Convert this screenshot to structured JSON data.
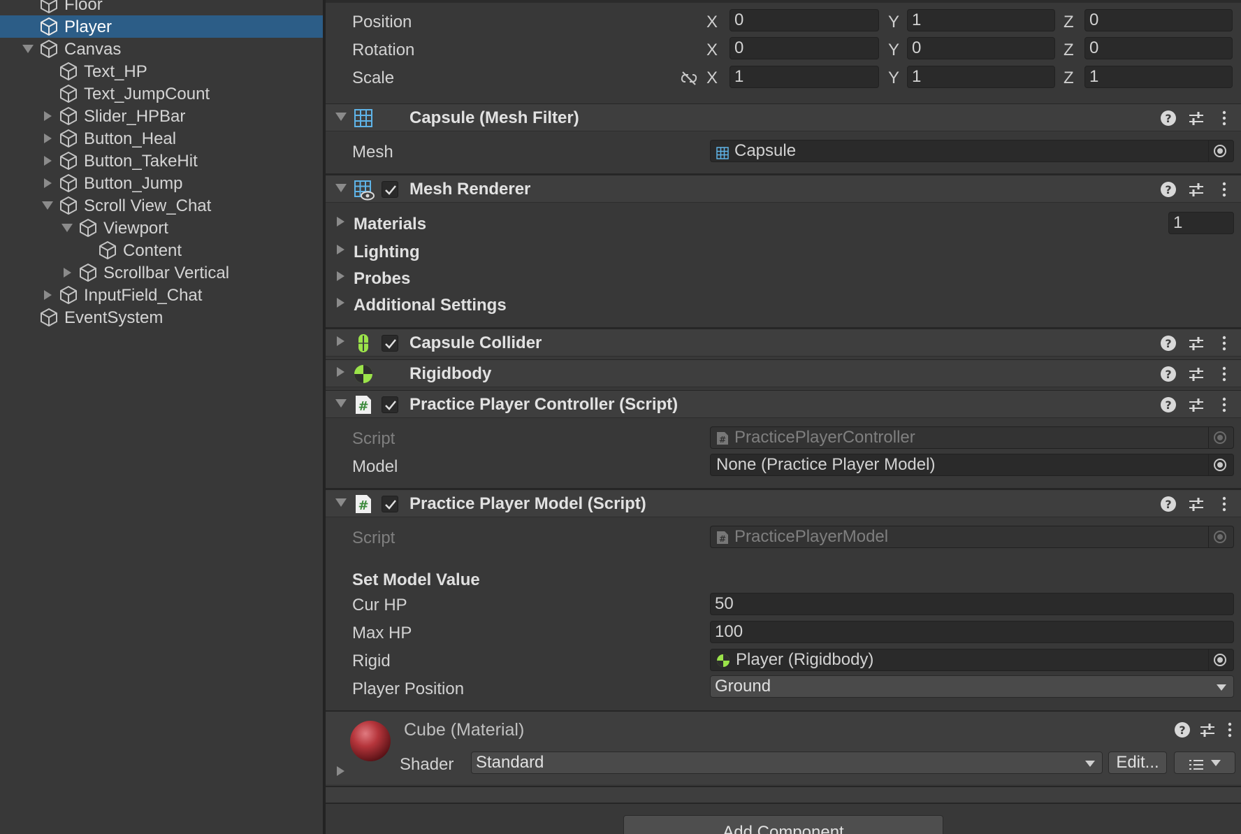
{
  "hierarchy": {
    "items": [
      {
        "label": "Floor",
        "indent": 0,
        "fold": "none",
        "selected": false
      },
      {
        "label": "Player",
        "indent": 0,
        "fold": "none",
        "selected": true
      },
      {
        "label": "Canvas",
        "indent": 0,
        "fold": "open",
        "selected": false
      },
      {
        "label": "Text_HP",
        "indent": 1,
        "fold": "none",
        "selected": false
      },
      {
        "label": "Text_JumpCount",
        "indent": 1,
        "fold": "none",
        "selected": false
      },
      {
        "label": "Slider_HPBar",
        "indent": 1,
        "fold": "closed",
        "selected": false
      },
      {
        "label": "Button_Heal",
        "indent": 1,
        "fold": "closed",
        "selected": false
      },
      {
        "label": "Button_TakeHit",
        "indent": 1,
        "fold": "closed",
        "selected": false
      },
      {
        "label": "Button_Jump",
        "indent": 1,
        "fold": "closed",
        "selected": false
      },
      {
        "label": "Scroll View_Chat",
        "indent": 1,
        "fold": "open",
        "selected": false
      },
      {
        "label": "Viewport",
        "indent": 2,
        "fold": "open",
        "selected": false
      },
      {
        "label": "Content",
        "indent": 3,
        "fold": "none",
        "selected": false
      },
      {
        "label": "Scrollbar Vertical",
        "indent": 2,
        "fold": "closed",
        "selected": false
      },
      {
        "label": "InputField_Chat",
        "indent": 1,
        "fold": "closed",
        "selected": false
      },
      {
        "label": "EventSystem",
        "indent": 0,
        "fold": "none",
        "selected": false
      }
    ]
  },
  "transform": {
    "position": {
      "label": "Position",
      "x": "0",
      "y": "1",
      "z": "0"
    },
    "rotation": {
      "label": "Rotation",
      "x": "0",
      "y": "0",
      "z": "0"
    },
    "scale": {
      "label": "Scale",
      "x": "1",
      "y": "1",
      "z": "1"
    },
    "axis_x": "X",
    "axis_y": "Y",
    "axis_z": "Z"
  },
  "mesh_filter": {
    "title": "Capsule (Mesh Filter)",
    "mesh_label": "Mesh",
    "mesh_value": "Capsule"
  },
  "mesh_renderer": {
    "title": "Mesh Renderer",
    "sections": [
      "Materials",
      "Lighting",
      "Probes",
      "Additional Settings"
    ],
    "materials_count": "1"
  },
  "capsule_collider": {
    "title": "Capsule Collider"
  },
  "rigidbody": {
    "title": "Rigidbody"
  },
  "controller": {
    "title": "Practice Player Controller (Script)",
    "script_label": "Script",
    "script_value": "PracticePlayerController",
    "model_label": "Model",
    "model_value": "None (Practice Player Model)"
  },
  "model": {
    "title": "Practice Player Model (Script)",
    "script_label": "Script",
    "script_value": "PracticePlayerModel",
    "section": "Set Model Value",
    "cur_hp_label": "Cur HP",
    "cur_hp": "50",
    "max_hp_label": "Max HP",
    "max_hp": "100",
    "rigid_label": "Rigid",
    "rigid_value": "Player (Rigidbody)",
    "player_position_label": "Player Position",
    "player_position": "Ground"
  },
  "material": {
    "title": "Cube (Material)",
    "shader_label": "Shader",
    "shader_value": "Standard",
    "edit_label": "Edit...",
    "sphere_color": "#b5353b"
  },
  "add_component": "Add Component",
  "colors": {
    "selected": "#2c5d87",
    "accent_green": "#9be34a",
    "mesh_blue": "#5fb4e8"
  }
}
